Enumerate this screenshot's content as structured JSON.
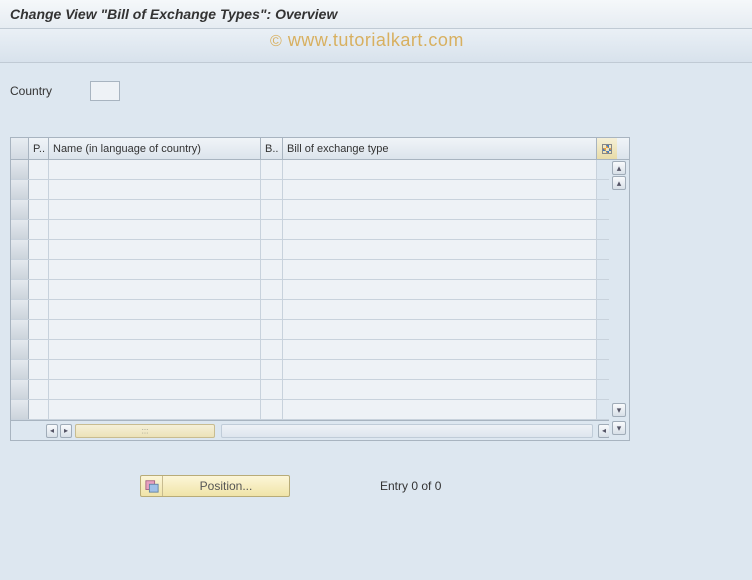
{
  "header": {
    "title": "Change View \"Bill of Exchange Types\": Overview"
  },
  "watermark": "www.tutorialkart.com",
  "filter": {
    "country_label": "Country",
    "country_value": ""
  },
  "table": {
    "columns": {
      "p": "P..",
      "name": "Name (in language of country)",
      "b": "B..",
      "bill": "Bill of exchange type"
    }
  },
  "footer": {
    "position_label": "Position...",
    "entry_text": "Entry 0 of 0"
  }
}
